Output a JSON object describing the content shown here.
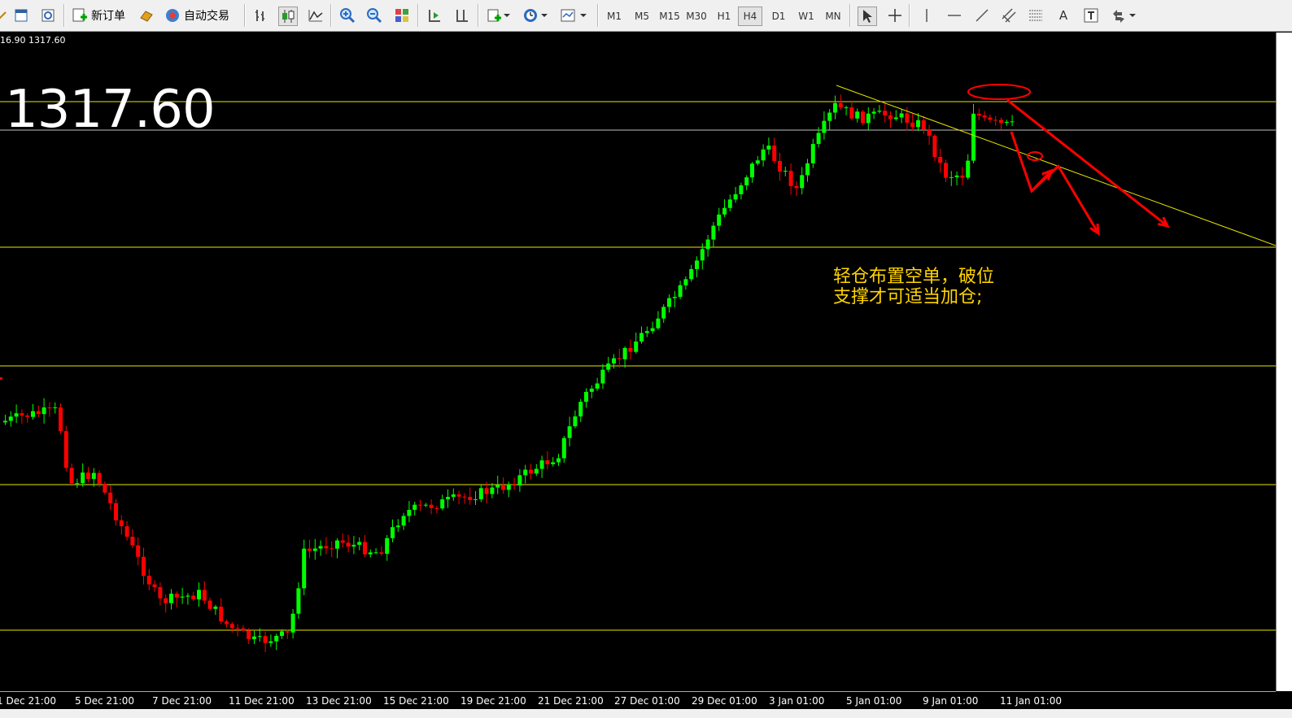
{
  "toolbar": {
    "new_order_label": "新订单",
    "auto_trade_label": "自动交易",
    "timeframes": [
      "M1",
      "M5",
      "M15",
      "M30",
      "H1",
      "H4",
      "D1",
      "W1",
      "MN"
    ],
    "active_timeframe": "H4",
    "tools": [
      "cursor-icon",
      "crosshair-icon",
      "vertical-line-icon",
      "horizontal-line-icon",
      "trendline-icon",
      "channel-icon",
      "fibonacci-icon",
      "text-icon",
      "text-label-icon",
      "arrows-icon"
    ]
  },
  "chart": {
    "info_line": "16.90 1317.60",
    "current_price": "1317.60",
    "annotation_line1": "轻仓布置空单，破位",
    "annotation_line2": "支撑才可适当加仓;",
    "time_labels": [
      "1 Dec 21:00",
      "5 Dec 21:00",
      "7 Dec 21:00",
      "11 Dec 21:00",
      "13 Dec 21:00",
      "15 Dec 21:00",
      "19 Dec 21:00",
      "21 Dec 21:00",
      "27 Dec 01:00",
      "29 Dec 01:00",
      "3 Jan 01:00",
      "5 Jan 01:00",
      "9 Jan 01:00",
      "11 Jan 01:00"
    ],
    "colors": {
      "background": "#000000",
      "bull_candle": "#00ff00",
      "bear_candle": "#ff0000",
      "level_line": "#e6e600",
      "annotation": "#ffd400",
      "markup": "#ff0000",
      "bid_line": "#c0c0c0"
    }
  }
}
